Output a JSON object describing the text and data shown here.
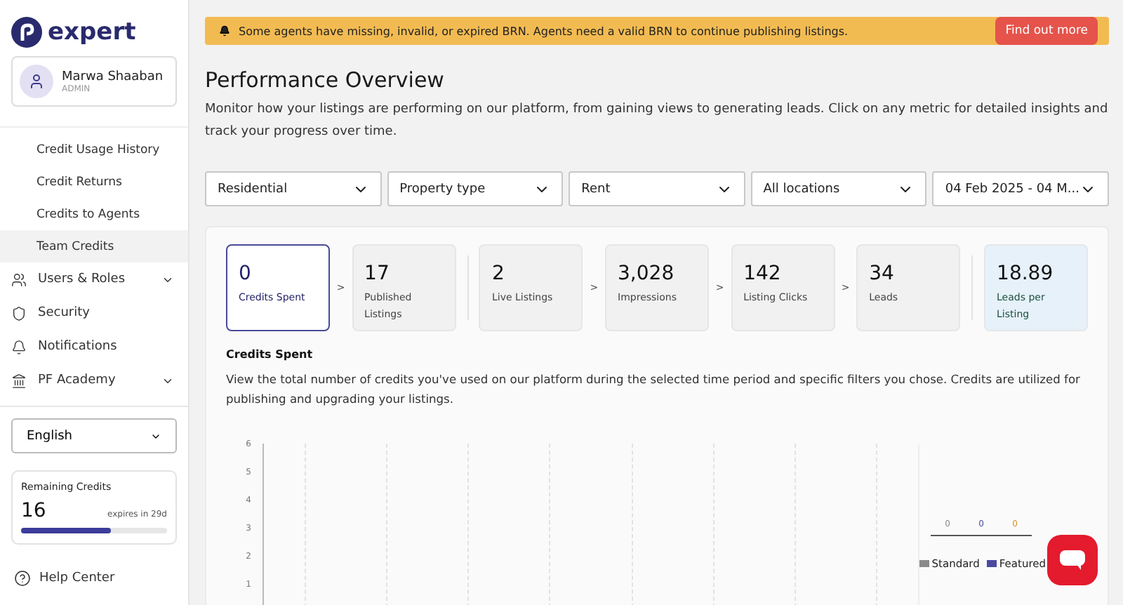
{
  "sidebar": {
    "logo": "expert",
    "user": {
      "name": "Marwa Shaaban",
      "role": "ADMIN"
    },
    "sub_items": [
      {
        "label": "Credit Usage History",
        "selected": false
      },
      {
        "label": "Credit Returns",
        "selected": false
      },
      {
        "label": "Credits to Agents",
        "selected": false
      },
      {
        "label": "Team Credits",
        "selected": true
      }
    ],
    "items": [
      {
        "label": "Users & Roles",
        "expandable": true
      },
      {
        "label": "Security",
        "expandable": false
      },
      {
        "label": "Notifications",
        "expandable": false
      },
      {
        "label": "PF Academy",
        "expandable": true
      }
    ],
    "language": "English",
    "credits": {
      "title": "Remaining Credits",
      "value": "16",
      "expiry": "expires in 29d",
      "level": 0.62
    },
    "help": "Help Center"
  },
  "banner": {
    "message": "Some agents have missing, invalid, or expired BRN. Agents need a valid BRN to continue publishing listings.",
    "button": "Find out more"
  },
  "title": "Performance Overview",
  "subtitle": "Monitor how your listings are performing on our platform, from gaining views to generating leads. Click on any metric for detailed insights and track your progress over time.",
  "filters": [
    "Residential",
    "Property type",
    "Rent",
    "All locations",
    "04 Feb 2025 - 04 M..."
  ],
  "metrics": [
    {
      "value": "0",
      "label": "Credits Spent",
      "selected": true,
      "divider_before": false,
      "highlighted": false
    },
    {
      "arrow": ">",
      "value": "17",
      "label": "Published Listings",
      "selected": false,
      "divider_before": false,
      "highlighted": false
    },
    {
      "value": "2",
      "label": "Live Listings",
      "selected": false,
      "divider_before": true,
      "highlighted": false
    },
    {
      "arrow": ">",
      "value": "3,028",
      "label": "Impressions",
      "selected": false,
      "divider_before": false,
      "highlighted": false
    },
    {
      "arrow": ">",
      "value": "142",
      "label": "Listing Clicks",
      "selected": false,
      "divider_before": false,
      "highlighted": false
    },
    {
      "arrow": ">",
      "value": "34",
      "label": "Leads",
      "selected": false,
      "divider_before": false,
      "highlighted": false
    },
    {
      "value": "18.89",
      "label": "Leads per Listing",
      "selected": false,
      "divider_before": true,
      "highlighted": true
    }
  ],
  "section": {
    "title": "Credits Spent",
    "description": "View the total number of credits you've used on our platform during the selected time period and specific filters you chose. Credits are utilized for publishing and upgrading your listings.",
    "chart": {
      "y_ticks": [
        "6",
        "5",
        "4",
        "3",
        "2",
        "1"
      ],
      "totals": [
        {
          "value": "0",
          "color": "#8a8a8a"
        },
        {
          "value": "0",
          "color": "#4a4aa0"
        },
        {
          "value": "0",
          "color": "#d4912a"
        }
      ],
      "legend": [
        {
          "label": "Standard",
          "color": "#8a8a8a"
        },
        {
          "label": "Featured",
          "color": "#4a4aa0"
        }
      ]
    }
  }
}
